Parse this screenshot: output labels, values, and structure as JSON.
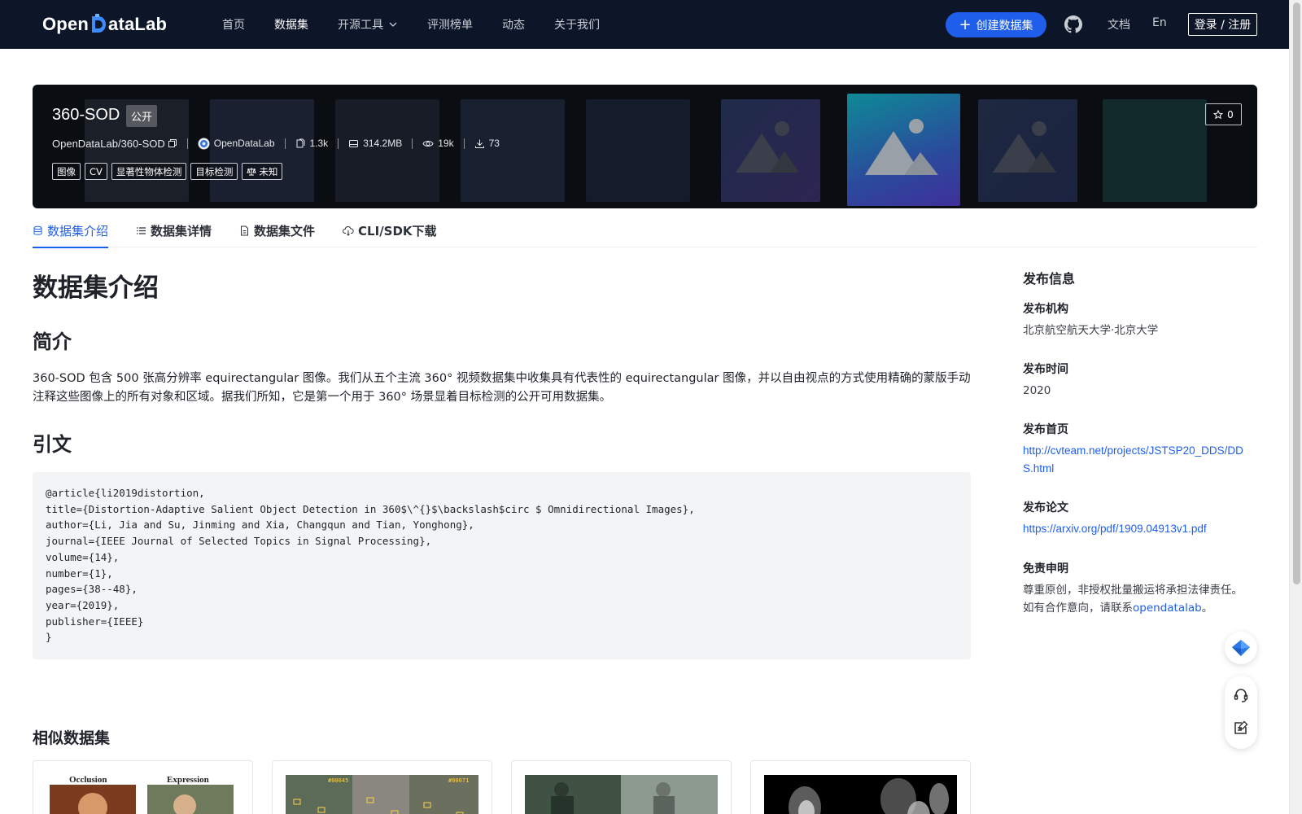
{
  "nav": {
    "logo_text": "OpenDataLab",
    "items": [
      {
        "label": "首页",
        "active": false
      },
      {
        "label": "数据集",
        "active": true
      },
      {
        "label": "开源工具",
        "active": false,
        "has_dropdown": true
      },
      {
        "label": "评测榜单",
        "active": false
      },
      {
        "label": "动态",
        "active": false
      },
      {
        "label": "关于我们",
        "active": false
      }
    ],
    "create_label": "创建数据集",
    "docs_label": "文档",
    "lang_label": "En",
    "login_label": "登录 / 注册",
    "accent": "#1f5eea"
  },
  "banner": {
    "title": "360-SOD",
    "visibility": "公开",
    "repo": "OpenDataLab/360-SOD",
    "org": "OpenDataLab",
    "files": "1.3k",
    "size": "314.2MB",
    "views": "19k",
    "downloads": "73",
    "tags": [
      "图像",
      "CV",
      "显著性物体检测",
      "目标检测",
      "未知"
    ],
    "stars": "0"
  },
  "tabs": [
    {
      "label": "数据集介绍",
      "icon": "database-icon",
      "active": true
    },
    {
      "label": "数据集详情",
      "icon": "list-icon",
      "active": false
    },
    {
      "label": "数据集文件",
      "icon": "file-icon",
      "active": false
    },
    {
      "label": "CLI/SDK下载",
      "icon": "cloud-download-icon",
      "active": false
    }
  ],
  "content": {
    "heading": "数据集介绍",
    "intro_heading": "简介",
    "intro_text": "360-SOD 包含 500 张高分辨率 equirectangular 图像。我们从五个主流 360° 视频数据集中收集具有代表性的 equirectangular 图像，并以自由视点的方式使用精确的蒙版手动注释这些图像上的所有对象和区域。据我们所知，它是第一个用于 360° 场景显着目标检测的公开可用数据集。",
    "citation_heading": "引文",
    "citation_lines": [
      "@article{li2019distortion,",
      "title={Distortion-Adaptive Salient Object Detection in 360$\\^{}$\\backslash$circ $ Omnidirectional Images},",
      "author={Li, Jia and Su, Jinming and Xia, Changqun and Tian, Yonghong},",
      "journal={IEEE Journal of Selected Topics in Signal Processing},",
      "volume={14},",
      "number={1},",
      "pages={38--48},",
      "year={2019},",
      "publisher={IEEE}",
      "}"
    ],
    "similar_heading": "相似数据集",
    "similar_cards": [
      {
        "caption_left": "Occlusion",
        "caption_right": "Expression"
      },
      {
        "caption_left": "#00045",
        "caption_right": "#00071"
      },
      {
        "caption_left": "",
        "caption_right": ""
      },
      {
        "caption_left": "",
        "caption_right": ""
      }
    ]
  },
  "sidebar": {
    "title": "发布信息",
    "org_label": "发布机构",
    "org_value": "北京航空航天大学·北京大学",
    "time_label": "发布时间",
    "time_value": "2020",
    "homepage_label": "发布首页",
    "homepage_value": "http://cvteam.net/projects/JSTSP20_DDS/DDS.html",
    "paper_label": "发布论文",
    "paper_value": "https://arxiv.org/pdf/1909.04913v1.pdf",
    "disclaimer_label": "免责申明",
    "disclaimer_line1": "尊重原创，非授权批量搬运将承担法律责任。",
    "disclaimer_line2_prefix": "如有合作意向，请联系",
    "disclaimer_link": "opendatalab",
    "disclaimer_suffix": "。"
  }
}
